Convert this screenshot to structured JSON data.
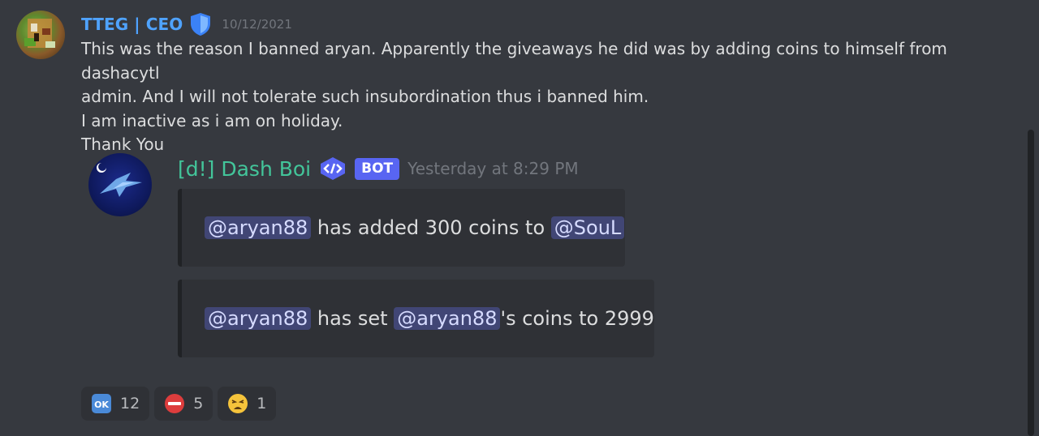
{
  "message": {
    "author": "TTEG | CEO",
    "timestamp": "10/12/2021",
    "lines": [
      "This was the reason I banned aryan. Apparently the giveaways he did was by adding coins to himself from dashacytl",
      "admin. And I will not tolerate such insubordination thus i banned him.",
      "I am inactive as i am on holiday.",
      "Thank You"
    ]
  },
  "bot": {
    "name": "[d!] Dash Boi",
    "tag": "BOT",
    "timestamp": "Yesterday at 8:29 PM"
  },
  "embeds": [
    {
      "mention1": "@aryan88",
      "text1": " has added 300 coins to ",
      "mention2": "@SouL",
      "text2": ""
    },
    {
      "mention1": "@aryan88",
      "text1": " has set ",
      "mention2": "@aryan88",
      "text2": "'s coins to 2999"
    }
  ],
  "reactions": [
    {
      "icon": "ok-emoji",
      "count": "12"
    },
    {
      "icon": "no-entry-emoji",
      "count": "5"
    },
    {
      "icon": "tired-face-emoji",
      "count": "1"
    }
  ],
  "colors": {
    "background": "#36393f",
    "username": "#4fa3ff",
    "bot_name": "#43c59a",
    "bot_tag": "#5865f2",
    "mention_bg": "#414675"
  }
}
